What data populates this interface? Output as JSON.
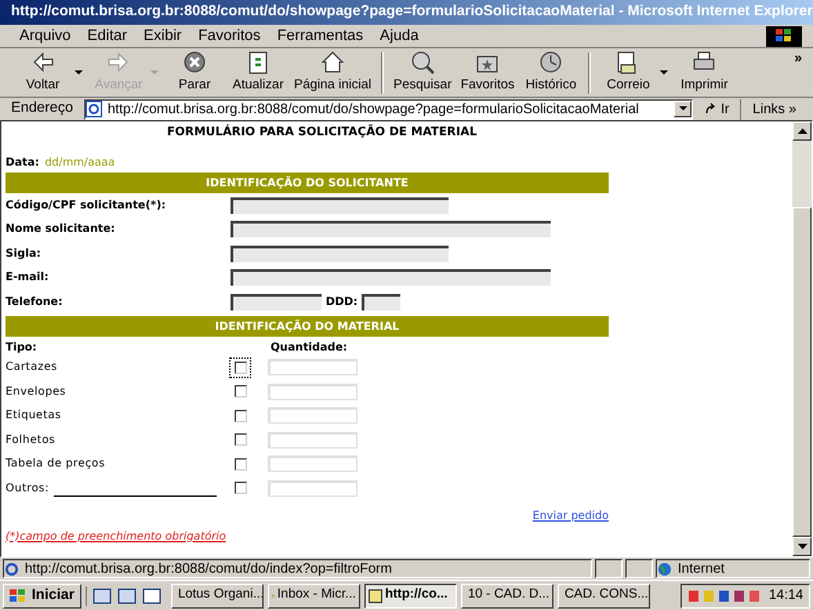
{
  "window": {
    "title": "http://comut.brisa.org.br:8088/comut/do/showpage?page=formularioSolicitacaoMaterial - Microsoft Internet Explorer"
  },
  "menu": [
    "Arquivo",
    "Editar",
    "Exibir",
    "Favoritos",
    "Ferramentas",
    "Ajuda"
  ],
  "toolbar": [
    {
      "kind": "back",
      "label": "Voltar",
      "disabled": false,
      "dropdown": true
    },
    {
      "kind": "forward",
      "label": "Avançar",
      "disabled": true,
      "dropdown": true
    },
    {
      "kind": "stop",
      "label": "Parar",
      "disabled": false,
      "dropdown": false
    },
    {
      "kind": "refresh",
      "label": "Atualizar",
      "disabled": false,
      "dropdown": false
    },
    {
      "kind": "home",
      "label": "Página inicial",
      "disabled": false,
      "dropdown": false
    },
    {
      "kind": "search",
      "label": "Pesquisar",
      "disabled": false,
      "dropdown": false
    },
    {
      "kind": "favorites",
      "label": "Favoritos",
      "disabled": false,
      "dropdown": false
    },
    {
      "kind": "history",
      "label": "Histórico",
      "disabled": false,
      "dropdown": false
    },
    {
      "kind": "mail",
      "label": "Correio",
      "disabled": false,
      "dropdown": true
    },
    {
      "kind": "print",
      "label": "Imprimir",
      "disabled": false,
      "dropdown": false
    }
  ],
  "toolbar_more": "»",
  "address": {
    "label": "Endereço",
    "value": "http://comut.brisa.org.br:8088/comut/do/showpage?page=formularioSolicitacaoMaterial",
    "go": "Ir",
    "links": "Links",
    "links_more": "»"
  },
  "form": {
    "title": "FORMULÁRIO PARA SOLICITAÇÃO DE MATERIAL",
    "date_label": "Data:",
    "date_value": "dd/mm/aaaa",
    "section_1": "IDENTIFICAÇÃO DO SOLICITANTE",
    "fields": [
      {
        "label": "Código/CPF solicitante(*):",
        "kind": "medium"
      },
      {
        "label": "Nome solicitante:",
        "kind": "wide"
      },
      {
        "label": "Sigla:",
        "kind": "medium"
      },
      {
        "label": "E-mail:",
        "kind": "wide"
      },
      {
        "label": "Telefone:",
        "kind": "phone",
        "extra_label": "DDD:"
      }
    ],
    "section_2": "IDENTIFICAÇÃO DO MATERIAL",
    "type_label": "Tipo:",
    "quantity_label": "Quantidade:",
    "materials": [
      {
        "kind": "fixed",
        "label": "Cartazes",
        "checked": false,
        "focused": true
      },
      {
        "kind": "fixed",
        "label": "Envelopes",
        "checked": false,
        "focused": false
      },
      {
        "kind": "fixed",
        "label": "Etiquetas",
        "checked": false,
        "focused": false
      },
      {
        "kind": "fixed",
        "label": "Folhetos",
        "checked": false,
        "focused": false
      },
      {
        "kind": "fixed",
        "label": "Tabela de preços",
        "checked": false,
        "focused": false
      },
      {
        "kind": "write_in",
        "label": "Outros:",
        "checked": false,
        "focused": false
      }
    ],
    "submit": "Enviar pedido",
    "note": "(*)campo de preenchimento obrigatório"
  },
  "status_bar": {
    "url": "http://comut.brisa.org.br:8088/comut/do/index?op=filtroForm",
    "zone": "Internet"
  },
  "taskbar": {
    "start": "Iniciar",
    "tasks": [
      {
        "label": "Lotus Organi...",
        "selected": false
      },
      {
        "label": "Inbox - Micr...",
        "selected": false
      },
      {
        "label": "http://co...",
        "selected": true
      },
      {
        "label": "10 - CAD. D...",
        "selected": false
      },
      {
        "label": "CAD. CONS...",
        "selected": false
      }
    ],
    "clock": "14:14"
  }
}
